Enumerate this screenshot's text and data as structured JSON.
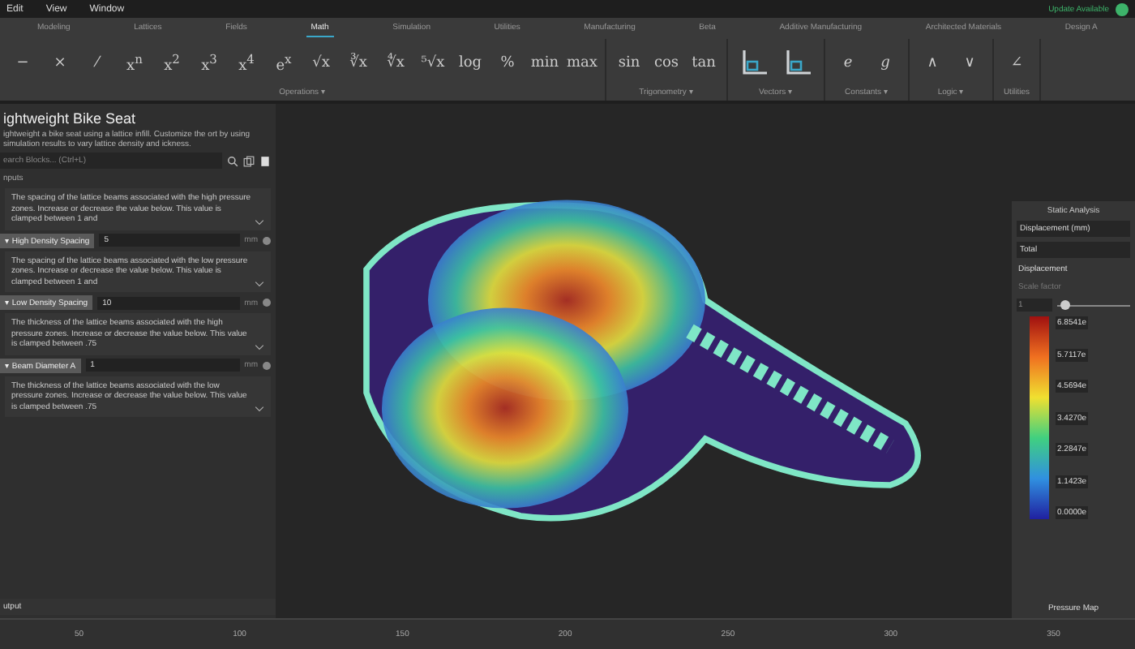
{
  "menu": [
    "Edit",
    "View",
    "Window"
  ],
  "update_notice": "Update Available",
  "tabs": [
    {
      "label": "Modeling",
      "selected": false
    },
    {
      "label": "Lattices",
      "selected": false
    },
    {
      "label": "Fields",
      "selected": false
    },
    {
      "label": "Math",
      "selected": true
    },
    {
      "label": "Simulation",
      "selected": false
    },
    {
      "label": "Utilities",
      "selected": false
    },
    {
      "label": "Manufacturing",
      "selected": false
    },
    {
      "label": "Beta",
      "selected": false
    },
    {
      "label": "Additive Manufacturing",
      "selected": false
    },
    {
      "label": "Architected Materials",
      "selected": false
    },
    {
      "label": "Design A",
      "selected": false
    }
  ],
  "toolbar_groups": [
    {
      "label": "Operations ▾",
      "tools": [
        "−",
        "×",
        "⁄",
        "x$^{n}$",
        "x$^{2}$",
        "x$^{3}$",
        "x$^{4}$",
        "e$^{x}$",
        "√x",
        "∛x",
        "∜x",
        "⁵√x",
        "log",
        "%",
        "min",
        "max"
      ]
    },
    {
      "label": "Trigonometry ▾",
      "tools": [
        "sin",
        "cos",
        "tan"
      ]
    },
    {
      "label": "Vectors ▾",
      "tools": [
        {
          "kind": "axes"
        },
        {
          "kind": "axes"
        }
      ]
    },
    {
      "label": "Constants ▾",
      "tools": [
        "*e*",
        "*g*"
      ]
    },
    {
      "label": "Logic ▾",
      "tools": [
        "∧",
        "∨"
      ]
    },
    {
      "label": "Utilities",
      "tools": [
        "∠"
      ]
    }
  ],
  "panel": {
    "title": "ightweight Bike Seat",
    "description": "ightweight a bike seat using a lattice infill. Customize the ort by using simulation results to vary lattice density and ickness.",
    "search": {
      "placeholder": "earch Blocks... (Ctrl+L)"
    },
    "section": "nputs",
    "blocks": [
      {
        "description": "The spacing of the lattice beams associated with the high pressure zones. Increase or decrease the value below. This value is clamped between 1 and",
        "input": {
          "caret": "▾",
          "name": "High Density Spacing",
          "value": "5",
          "unit": "mm"
        }
      },
      {
        "description": "The spacing of the lattice beams associated with the low pressure zones. Increase or decrease the value below. This value is clamped between 1 and",
        "input": {
          "caret": "▾",
          "name": "Low Density Spacing",
          "value": "10",
          "unit": "mm"
        }
      },
      {
        "description": "The thickness of the lattice beams associated with the high pressure zones. Increase or decrease the value below. This value is clamped between .75",
        "input": {
          "caret": "▾",
          "name": "Beam Diameter A",
          "value": "1",
          "unit": "mm"
        }
      },
      {
        "description": "The thickness of the lattice beams associated with the low pressure zones. Increase or decrease the value below. This value is clamped between .75"
      }
    ],
    "output": "utput"
  },
  "analysis": {
    "title": "Static Analysis",
    "result": "Displacement (mm)",
    "component": "Total",
    "section": "Displacement",
    "scale_label": "Scale factor",
    "scale_value": "1",
    "scale": {
      "level": 0.1
    },
    "legend": [
      "6.8541e",
      "5.7117e",
      "4.5694e",
      "3.4270e",
      "2.2847e",
      "1.1423e",
      "0.0000e"
    ],
    "footer": "Pressure Map"
  },
  "timeline": {
    "ticks": [
      "50",
      "100",
      "150",
      "200",
      "250",
      "300",
      "350"
    ]
  }
}
